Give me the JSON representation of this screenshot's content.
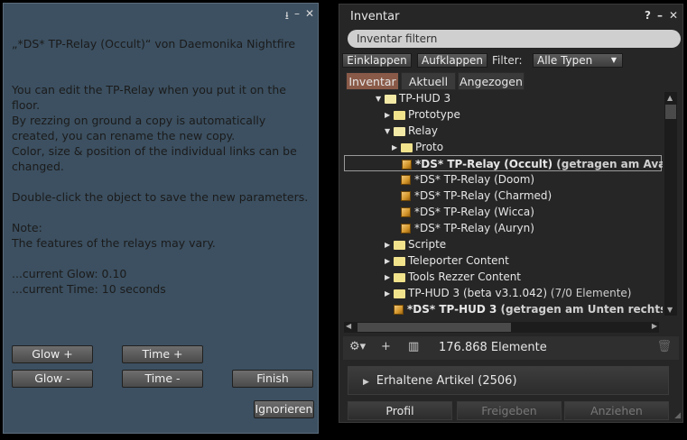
{
  "dialog": {
    "icons": [
      "download-icon",
      "minimize-icon",
      "close-icon"
    ],
    "lines": [
      "„*DS* TP-Relay (Occult)“ von Daemonika Nightfire",
      "",
      "",
      "You can edit the TP-Relay when you put it on the floor.",
      "By rezzing on ground a copy is automatically",
      "created, you can rename the new copy.",
      "Color, size & position of the individual links can be",
      "changed.",
      "",
      "Double-click the object to save the new parameters.",
      "",
      "Note:",
      "The features of the relays may vary.",
      "",
      "...current Glow: 0.10",
      "...current Time: 10 seconds"
    ],
    "buttons": {
      "glow_plus": "Glow +",
      "time_plus": "Time +",
      "glow_minus": "Glow -",
      "time_minus": "Time -",
      "finish": "Finish",
      "ignore": "Ignorieren"
    }
  },
  "inventory": {
    "title": "Inventar",
    "icons": [
      "help-icon",
      "minimize-icon",
      "close-icon"
    ],
    "search_placeholder": "Inventar filtern",
    "collapse": "Einklappen",
    "expand": "Aufklappen",
    "filter_label": "Filter:",
    "filter_value": "Alle Typen",
    "tabs": [
      "Inventar",
      "Aktuell",
      "Angezogen"
    ],
    "tree": [
      {
        "label": "TP-HUD 3",
        "suffix": "",
        "type": "folder-open",
        "arrow": "down",
        "indent": 0,
        "bold": false,
        "selected": false
      },
      {
        "label": "Prototype",
        "suffix": "",
        "type": "folder",
        "arrow": "right",
        "indent": 1,
        "bold": false,
        "selected": false
      },
      {
        "label": "Relay",
        "suffix": "",
        "type": "folder-open",
        "arrow": "down",
        "indent": 1,
        "bold": false,
        "selected": false
      },
      {
        "label": "Proto",
        "suffix": "",
        "type": "folder",
        "arrow": "right",
        "indent": 2,
        "bold": false,
        "selected": false
      },
      {
        "label": "*DS* TP-Relay (Occult)",
        "suffix": " (getragen am Avatar-",
        "type": "object",
        "arrow": "",
        "indent": 2,
        "bold": true,
        "selected": true
      },
      {
        "label": "*DS* TP-Relay (Doom)",
        "suffix": "",
        "type": "object",
        "arrow": "",
        "indent": 2,
        "bold": false,
        "selected": false
      },
      {
        "label": "*DS* TP-Relay (Charmed)",
        "suffix": "",
        "type": "object",
        "arrow": "",
        "indent": 2,
        "bold": false,
        "selected": false
      },
      {
        "label": "*DS* TP-Relay (Wicca)",
        "suffix": "",
        "type": "object",
        "arrow": "",
        "indent": 2,
        "bold": false,
        "selected": false
      },
      {
        "label": "*DS* TP-Relay (Auryn)",
        "suffix": "",
        "type": "object",
        "arrow": "",
        "indent": 2,
        "bold": false,
        "selected": false
      },
      {
        "label": "Scripte",
        "suffix": "",
        "type": "folder",
        "arrow": "right",
        "indent": 1,
        "bold": false,
        "selected": false
      },
      {
        "label": "Teleporter Content",
        "suffix": "",
        "type": "folder",
        "arrow": "right",
        "indent": 1,
        "bold": false,
        "selected": false
      },
      {
        "label": "Tools Rezzer Content",
        "suffix": "",
        "type": "folder",
        "arrow": "right",
        "indent": 1,
        "bold": false,
        "selected": false
      },
      {
        "label": "TP-HUD 3 (beta v3.1.042)",
        "suffix": " (7/0 Elemente)",
        "type": "folder",
        "arrow": "right",
        "indent": 1,
        "bold": false,
        "selected": false
      },
      {
        "label": "*DS* TP-HUD 3",
        "suffix": " (getragen am Unten rechts)",
        "type": "object",
        "arrow": "",
        "indent": 1,
        "bold": true,
        "selected": false
      }
    ],
    "count": "176.868 Elemente",
    "received": "Erhaltene Artikel (2506)",
    "profile": "Profil",
    "share": "Freigeben",
    "wear": "Anziehen"
  }
}
